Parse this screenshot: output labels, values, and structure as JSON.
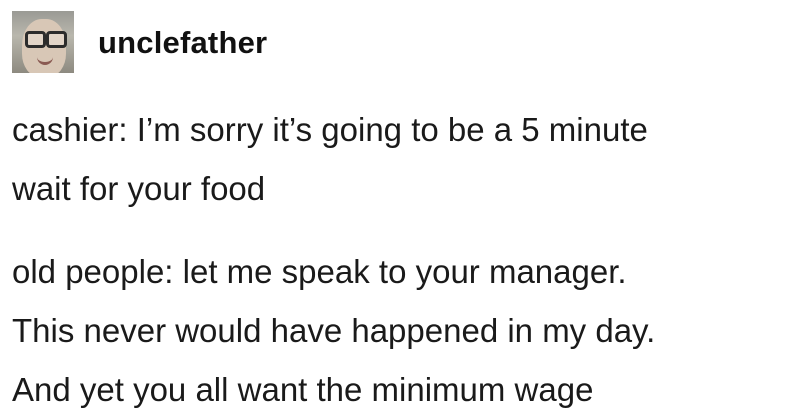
{
  "post": {
    "author": {
      "username": "unclefather",
      "avatar_icon": "user-avatar"
    },
    "paragraphs": [
      {
        "lines": [
          "cashier: I’m sorry it’s going to be a 5 minute",
          "wait for your food"
        ]
      },
      {
        "lines": [
          "old people: let me speak to your manager.",
          "This never would have happened in my day.",
          "And yet you all want the minimum wage"
        ]
      }
    ]
  }
}
